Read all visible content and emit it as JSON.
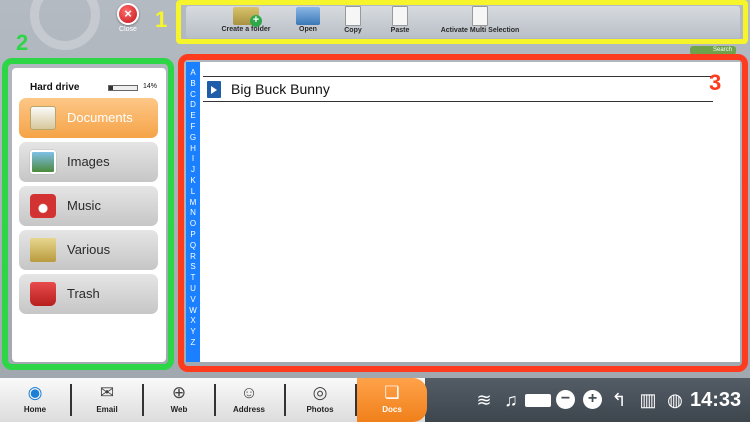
{
  "close": {
    "label": "Close"
  },
  "annotations": {
    "one": "1",
    "two": "2",
    "three": "3"
  },
  "toolbar": {
    "create_folder": "Create a folder",
    "open": "Open",
    "copy": "Copy",
    "paste": "Paste",
    "multi_selection": "Activate Multi Selection"
  },
  "search": {
    "label": "Search"
  },
  "sidebar": {
    "drive_label": "Hard drive",
    "drive_usage": "14%",
    "drive_fill": 14,
    "items": [
      {
        "label": "Documents",
        "icon": "documents-icon"
      },
      {
        "label": "Images",
        "icon": "images-icon"
      },
      {
        "label": "Music",
        "icon": "music-icon"
      },
      {
        "label": "Various",
        "icon": "various-folder-icon"
      },
      {
        "label": "Trash",
        "icon": "trash-icon"
      }
    ]
  },
  "alphabet": [
    "A",
    "B",
    "C",
    "D",
    "E",
    "F",
    "G",
    "H",
    "I",
    "J",
    "K",
    "L",
    "M",
    "N",
    "O",
    "P",
    "Q",
    "R",
    "S",
    "T",
    "U",
    "V",
    "W",
    "X",
    "Y",
    "Z"
  ],
  "files": [
    {
      "name": "Big Buck Bunny",
      "icon": "video-file-icon"
    }
  ],
  "taskbar": {
    "apps": [
      {
        "label": "Home",
        "icon": "home-icon"
      },
      {
        "label": "Email",
        "icon": "email-icon"
      },
      {
        "label": "Web",
        "icon": "web-globe-icon"
      },
      {
        "label": "Address",
        "icon": "address-book-icon"
      },
      {
        "label": "Photos",
        "icon": "camera-icon"
      },
      {
        "label": "Docs",
        "icon": "docs-icon"
      }
    ],
    "time": "14:33"
  },
  "colors": {
    "annotation_1": "#f6f42a",
    "annotation_2": "#2cd647",
    "annotation_3": "#fe3b1e",
    "active_nav": "#f5a347",
    "alpha_bar": "#1a80ff"
  }
}
